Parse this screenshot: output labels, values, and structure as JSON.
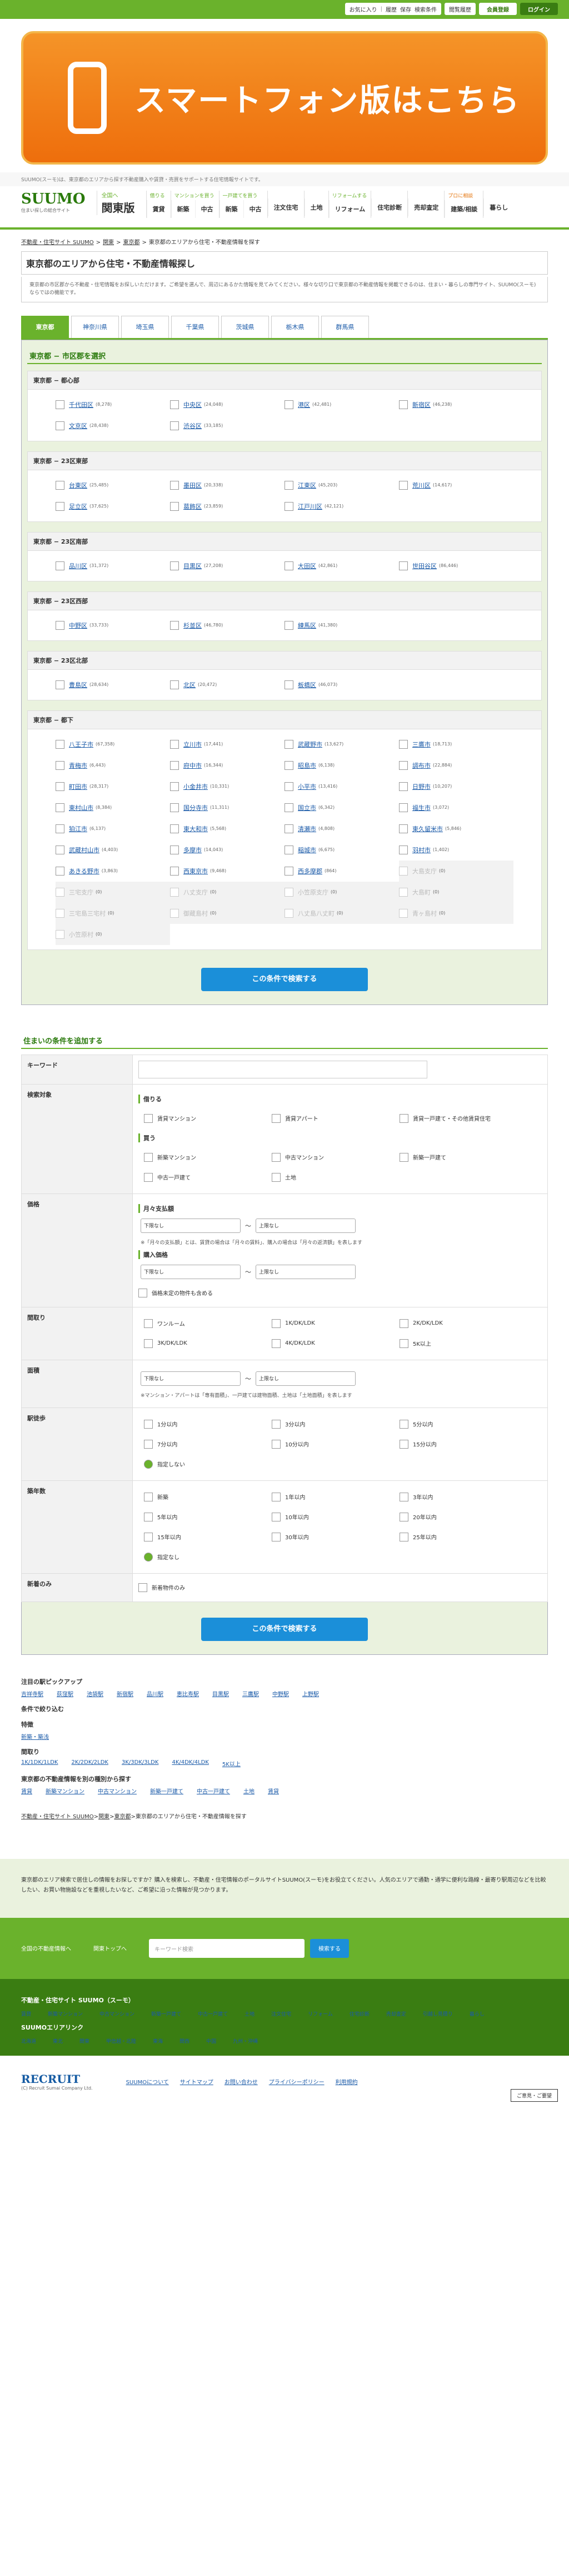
{
  "topbar": {
    "fav": "お気に入り",
    "history": "履歴",
    "save": "保存",
    "search_cond": "検索条件",
    "recent": "閲覧履歴",
    "member": "会員登録",
    "login": "ログイン"
  },
  "sp_banner": {
    "text": "スマートフォン版はこちら"
  },
  "note": "SUUMO(スーモ)は、東京都のエリアから探す不動産購入や賃貸・売買をサポートする住宅情報サイトです。",
  "header": {
    "logo": "SUUMO",
    "logo_sub": "住まい探しの総合サイト",
    "region_top": "全国へ",
    "region": "関東版",
    "nav": [
      {
        "head": "借りる",
        "items": [
          "賃貸"
        ]
      },
      {
        "head": "マンションを買う",
        "items": [
          "新築",
          "中古"
        ]
      },
      {
        "head": "一戸建てを買う",
        "items": [
          "新築",
          "中古"
        ]
      },
      {
        "head": "",
        "items": [
          "注文住宅"
        ]
      },
      {
        "head": "",
        "items": [
          "土地"
        ]
      },
      {
        "head": "リフォームする",
        "items": [
          "リフォーム"
        ]
      },
      {
        "head": "",
        "items": [
          "住宅診断"
        ]
      },
      {
        "head": "",
        "items": [
          "売却査定"
        ]
      },
      {
        "head": "プロに相談",
        "items": [
          "建築/相談"
        ]
      },
      {
        "head": "",
        "items": [
          "暮らし"
        ]
      }
    ]
  },
  "breadcrumb": [
    "不動産・住宅サイト SUUMO",
    "関東",
    "東京都",
    "東京都のエリアから住宅・不動産情報を探す"
  ],
  "page_title": "東京都のエリアから住宅・不動産情報探し",
  "desc": "東京都の市区郡から不動産・住宅情報をお探しいただけます。ご希望を選んで、周辺にあるかた情報を見てみてください。様々な切り口で東京都の不動産情報を掲載できるのは、住まい・暮らしの専門サイト、SUUMO(スーモ)ならではの機能です。",
  "tabs": [
    "東京都",
    "神奈川県",
    "埼玉県",
    "千葉県",
    "茨城県",
    "栃木県",
    "群馬県"
  ],
  "area": {
    "title": "東京都 − 市区郡を選択",
    "groups": [
      {
        "name": "東京都 − 都心部",
        "items": [
          [
            "千代田区",
            "(8,278)"
          ],
          [
            "中央区",
            "(24,048)"
          ],
          [
            "港区",
            "(42,481)"
          ],
          [
            "新宿区",
            "(46,238)"
          ],
          [
            "文京区",
            "(28,438)"
          ],
          [
            "渋谷区",
            "(33,185)"
          ]
        ]
      },
      {
        "name": "東京都 − 23区東部",
        "items": [
          [
            "台東区",
            "(25,485)"
          ],
          [
            "墨田区",
            "(20,338)"
          ],
          [
            "江東区",
            "(45,203)"
          ],
          [
            "荒川区",
            "(14,617)"
          ],
          [
            "足立区",
            "(37,625)"
          ],
          [
            "葛飾区",
            "(23,859)"
          ],
          [
            "江戸川区",
            "(42,121)"
          ]
        ]
      },
      {
        "name": "東京都 − 23区南部",
        "items": [
          [
            "品川区",
            "(31,372)"
          ],
          [
            "目黒区",
            "(27,208)"
          ],
          [
            "大田区",
            "(42,861)"
          ],
          [
            "世田谷区",
            "(86,446)"
          ]
        ]
      },
      {
        "name": "東京都 − 23区西部",
        "items": [
          [
            "中野区",
            "(33,733)"
          ],
          [
            "杉並区",
            "(46,780)"
          ],
          [
            "練馬区",
            "(41,380)"
          ]
        ]
      },
      {
        "name": "東京都 − 23区北部",
        "items": [
          [
            "豊島区",
            "(28,634)"
          ],
          [
            "北区",
            "(20,472)"
          ],
          [
            "板橋区",
            "(46,073)"
          ]
        ]
      },
      {
        "name": "東京都 − 都下",
        "items": [
          [
            "八王子市",
            "(67,358)"
          ],
          [
            "立川市",
            "(17,441)"
          ],
          [
            "武蔵野市",
            "(13,627)"
          ],
          [
            "三鷹市",
            "(18,713)"
          ],
          [
            "青梅市",
            "(6,443)"
          ],
          [
            "府中市",
            "(16,344)"
          ],
          [
            "昭島市",
            "(6,138)"
          ],
          [
            "調布市",
            "(22,884)"
          ],
          [
            "町田市",
            "(28,317)"
          ],
          [
            "小金井市",
            "(10,331)"
          ],
          [
            "小平市",
            "(13,416)"
          ],
          [
            "日野市",
            "(10,207)"
          ],
          [
            "東村山市",
            "(8,384)"
          ],
          [
            "国分寺市",
            "(11,311)"
          ],
          [
            "国立市",
            "(6,342)"
          ],
          [
            "福生市",
            "(3,072)"
          ],
          [
            "狛江市",
            "(6,137)"
          ],
          [
            "東大和市",
            "(5,568)"
          ],
          [
            "清瀬市",
            "(4,808)"
          ],
          [
            "東久留米市",
            "(5,846)"
          ],
          [
            "武蔵村山市",
            "(4,403)"
          ],
          [
            "多摩市",
            "(14,043)"
          ],
          [
            "稲城市",
            "(6,675)"
          ],
          [
            "羽村市",
            "(1,402)"
          ],
          [
            "あきる野市",
            "(3,863)"
          ],
          [
            "西東京市",
            "(9,468)"
          ],
          [
            "西多摩郡",
            "(864)"
          ],
          [
            "大島支庁",
            "(0)"
          ],
          [
            "三宅支庁",
            "(0)"
          ],
          [
            "八丈支庁",
            "(0)"
          ],
          [
            "小笠原支庁",
            "(0)"
          ],
          [
            "大島町",
            "(0)"
          ],
          [
            "三宅島三宅村",
            "(0)"
          ],
          [
            "御蔵島村",
            "(0)"
          ],
          [
            "八丈島八丈町",
            "(0)"
          ],
          [
            "青ヶ島村",
            "(0)"
          ],
          [
            "小笠原村",
            "(0)"
          ]
        ]
      }
    ]
  },
  "disabled_start": 27,
  "search_btn": "この条件で検索する",
  "cond": {
    "title": "住まいの条件を追加する",
    "keyword": "キーワード",
    "target": "検索対象",
    "rent": "借りる",
    "rent_opts": [
      "賃貸マンション",
      "賃貸アパート",
      "賃貸一戸建て・その他賃貸住宅"
    ],
    "buy": "買う",
    "buy_opts": [
      "新築マンション",
      "中古マンション",
      "新築一戸建て",
      "中古一戸建て",
      "土地"
    ],
    "price": "価格",
    "monthly": "月々支払額",
    "min": "下限なし",
    "max": "上限なし",
    "tilde": "〜",
    "price_note": "※「月々の支払額」とは、賃貸の場合は「月々の賃料」、購入の場合は「月々の返済額」を表します",
    "purchase": "購入価格",
    "undecided": "価格未定の物件も含める",
    "layout": "間取り",
    "layout_opts": [
      "ワンルーム",
      "1K/DK/LDK",
      "2K/DK/LDK",
      "3K/DK/LDK",
      "4K/DK/LDK",
      "5K以上"
    ],
    "area_lbl": "面積",
    "area_note": "※マンション・アパートは「専有面積」、一戸建ては建物面積、土地は「土地面積」を表します",
    "walk": "駅徒歩",
    "walk_opts": [
      "1分以内",
      "3分以内",
      "5分以内",
      "7分以内",
      "10分以内",
      "15分以内",
      "指定しない"
    ],
    "age": "築年数",
    "age_opts": [
      "新築",
      "1年以内",
      "3年以内",
      "5年以内",
      "10年以内",
      "20年以内",
      "15年以内",
      "30年以内",
      "25年以内",
      "指定なし"
    ],
    "newonly": "新着のみ",
    "newonly_opt": "新着物件のみ"
  },
  "pickup": {
    "stations_h": "注目の駅ピックアップ",
    "stations": [
      "吉祥寺駅",
      "荻窪駅",
      "池袋駅",
      "新宿駅",
      "品川駅",
      "恵比寿駅",
      "目黒駅",
      "三鷹駅",
      "中野駅",
      "上野駅"
    ],
    "narrow_h": "条件で絞り込む",
    "feature_h": "特徴",
    "feature": [
      "新築・築浅"
    ],
    "madori_h": "間取り",
    "madori": [
      "1K/1DK/1LDK",
      "2K/2DK/2LDK",
      "3K/3DK/3LDK",
      "4K/4DK/4LDK",
      "5K以上"
    ],
    "others_h": "東京都の不動産情報を別の種別から探す",
    "others": [
      "賃貸",
      "新築マンション",
      "中古マンション",
      "新築一戸建て",
      "中古一戸建て",
      "土地",
      "賃貸"
    ]
  },
  "footer": {
    "intro": "東京都のエリア検索で居住しの情報をお探しですか？購入を検索し、不動産・住宅情報のポータルサイトSUUMO(スーモ)をお役立てください。人気のエリアで通勤・通学に便利な路線・最寄り駅周辺などを比較したい、お買い物施設などを重視したいなど、ご希望に沿った情報が見つかります。",
    "nav1": "全国の不動産情報へ",
    "nav2": "関東トップへ",
    "search_ph": "キーワード検索",
    "search_btn": "検索する",
    "links_h": "不動産・住宅サイト SUUMO（スーモ）",
    "links": [
      "賃貸",
      "新築マンション",
      "中古マンション",
      "新築一戸建て",
      "中古一戸建て",
      "土地",
      "注文住宅",
      "リフォーム",
      "住宅診断",
      "売却査定",
      "引越し見積り",
      "暮らし"
    ],
    "area_h": "SUUMOエリアリンク",
    "areas": [
      "北海道",
      "東北",
      "関東",
      "甲信越・北陸",
      "東海",
      "関西",
      "中国",
      "九州・沖縄"
    ],
    "company": "RECRUIT",
    "copyright": "(C) Recruit Sumai Company Ltd.",
    "fb": [
      "SUUMOについて",
      "サイトマップ",
      "お問い合わせ",
      "プライバシーポリシー",
      "利用規約"
    ],
    "feedback": "ご意見・ご要望"
  }
}
